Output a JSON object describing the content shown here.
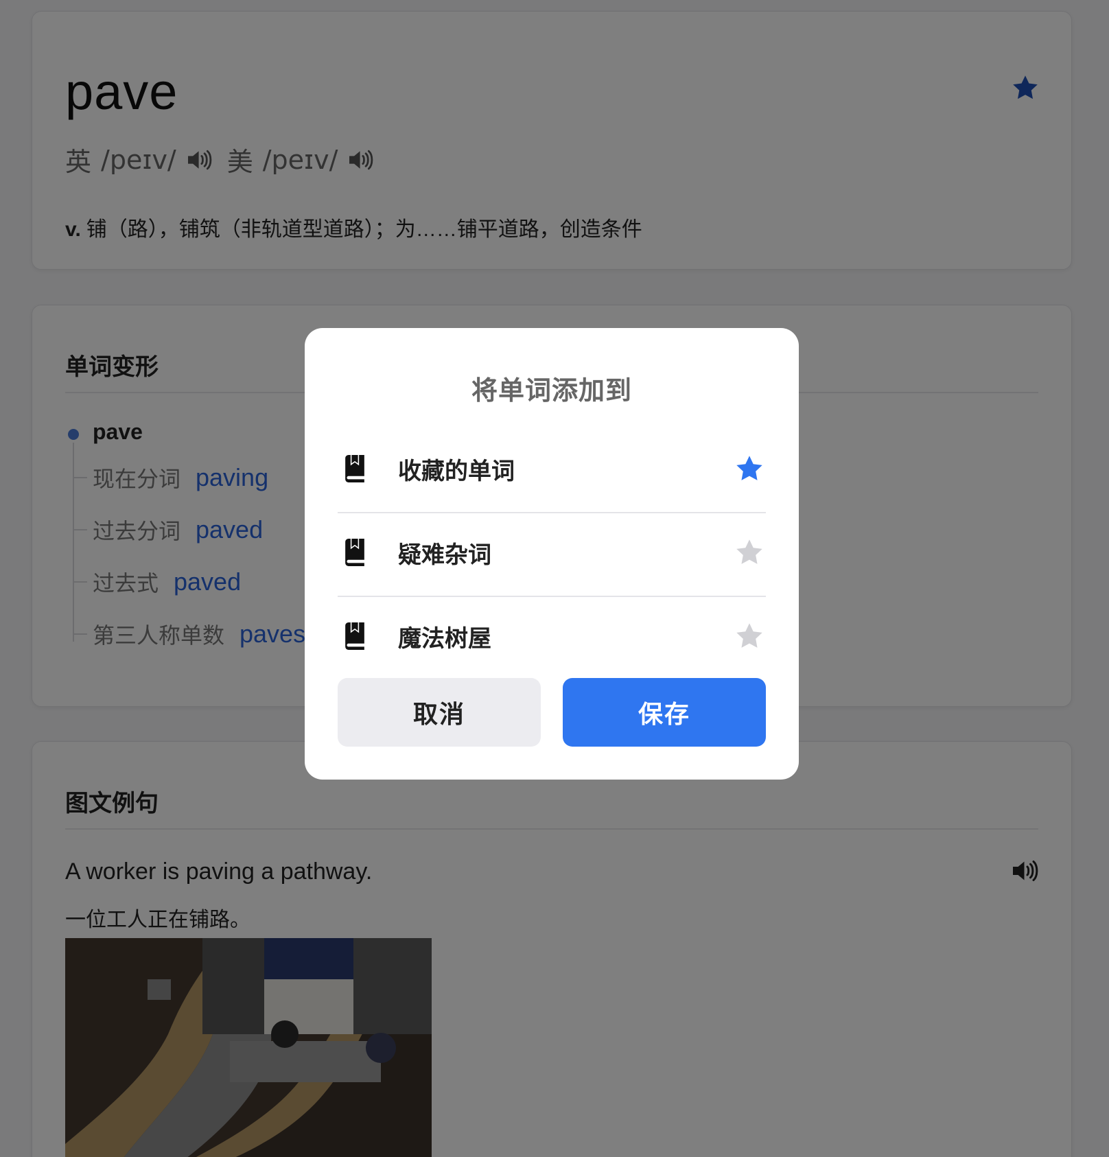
{
  "word_card": {
    "headword": "pave",
    "uk_prefix": "英",
    "uk_phonetic": "/peɪv/",
    "us_prefix": "美",
    "us_phonetic": "/peɪv/",
    "definition_pos": "v.",
    "definition_text": "铺（路），铺筑（非轨道型道路）；为……铺平道路，创造条件",
    "favorite_color": "#1f4fb5"
  },
  "forms_card": {
    "title": "单词变形",
    "base": "pave",
    "forms": [
      {
        "label": "现在分词",
        "word": "paving"
      },
      {
        "label": "过去分词",
        "word": "paved"
      },
      {
        "label": "过去式",
        "word": "paved"
      },
      {
        "label": "第三人称单数",
        "word": "paves"
      }
    ]
  },
  "examples_card": {
    "title": "图文例句",
    "sentence_en": "A worker is paving a pathway.",
    "sentence_zh": "一位工人正在铺路。"
  },
  "modal": {
    "title": "将单词添加到",
    "options": [
      {
        "name": "收藏的单词",
        "starred": true
      },
      {
        "name": "疑难杂词",
        "starred": false
      },
      {
        "name": "魔法树屋",
        "starred": false
      }
    ],
    "cancel_label": "取消",
    "save_label": "保存",
    "accent_color": "#2f76f0",
    "inactive_star_color": "#d0d0d4"
  }
}
